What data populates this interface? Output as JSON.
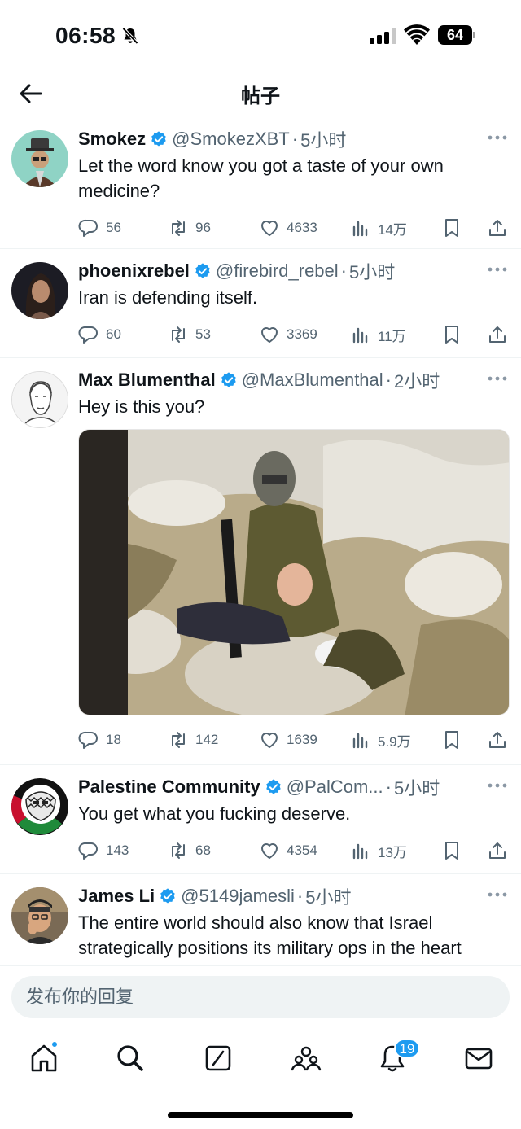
{
  "status_bar": {
    "time": "06:58",
    "battery": "64"
  },
  "header": {
    "title": "帖子"
  },
  "posts": [
    {
      "author": "Smokez",
      "handle": "@SmokezXBT",
      "time": "5小时",
      "text": "Let the word know you got a taste of your own medicine?",
      "replies": "56",
      "reposts": "96",
      "likes": "4633",
      "views": "14万",
      "verified": true
    },
    {
      "author": "phoenixrebel",
      "handle": "@firebird_rebel",
      "time": "5小时",
      "text": "Iran is defending itself.",
      "replies": "60",
      "reposts": "53",
      "likes": "3369",
      "views": "11万",
      "verified": true
    },
    {
      "author": "Max Blumenthal",
      "handle": "@MaxBlumenthal",
      "time": "2小时",
      "text": "Hey is this you?",
      "replies": "18",
      "reposts": "142",
      "likes": "1639",
      "views": "5.9万",
      "verified": true,
      "has_media": true
    },
    {
      "author": "Palestine Community",
      "handle": "@PalCom...",
      "time": "5小时",
      "text": "You get what you fucking deserve.",
      "replies": "143",
      "reposts": "68",
      "likes": "4354",
      "views": "13万",
      "verified": true
    },
    {
      "author": "James Li",
      "handle": "@5149jamesli",
      "time": "5小时",
      "text": "The entire world should also know that Israel strategically positions its military ops in the heart",
      "verified": true
    }
  ],
  "reply_bar": {
    "placeholder": "发布你的回复"
  },
  "tab_bar": {
    "notification_count": "19"
  },
  "colors": {
    "accent": "#1d9bf0",
    "text": "#0f1419",
    "secondary": "#536471"
  }
}
